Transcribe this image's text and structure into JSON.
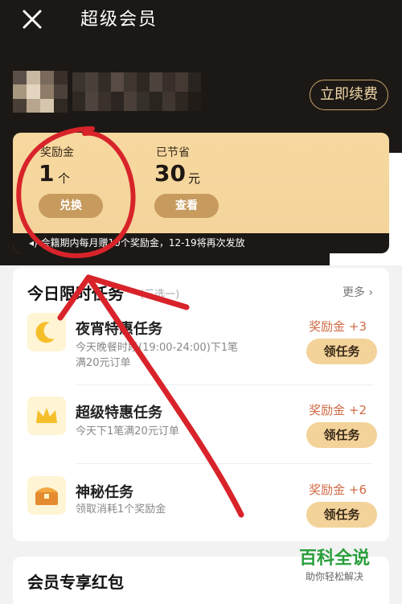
{
  "header": {
    "title": "超级会员"
  },
  "user": {
    "renew_label": "立即续费"
  },
  "card": {
    "bonus_label": "奖励金",
    "bonus_value": "1",
    "bonus_unit": "个",
    "saved_label": "已节省",
    "saved_value": "30",
    "saved_unit": "元",
    "exchange_label": "兑换",
    "view_label": "查看",
    "note": "会籍期内每月赠10个奖励金，12-19将再次发放"
  },
  "tasks_panel": {
    "title": "今日限时任务",
    "subtitle": "(三选一)",
    "more": "更多",
    "tasks": [
      {
        "name": "夜宵特惠任务",
        "desc": "今天晚餐时段(19:00-24:00)下1笔满20元订单",
        "reward": "奖励金 +3",
        "button": "领任务"
      },
      {
        "name": "超级特惠任务",
        "desc": "今天下1笔满20元订单",
        "reward": "奖励金 +2",
        "button": "领任务"
      },
      {
        "name": "神秘任务",
        "desc": "领取消耗1个奖励金",
        "reward": "奖励金 +6",
        "button": "领任务"
      }
    ]
  },
  "red_packet_panel": {
    "title": "会员专享红包"
  },
  "watermark": {
    "brand": "百科全说",
    "slogan": "助你轻松解决"
  },
  "colors": {
    "dark_bg": "#1c1815",
    "gold": "#f3d39a",
    "button_brown": "#c79a5d",
    "reward": "#d06a45",
    "annotation_red": "#d8232a"
  }
}
